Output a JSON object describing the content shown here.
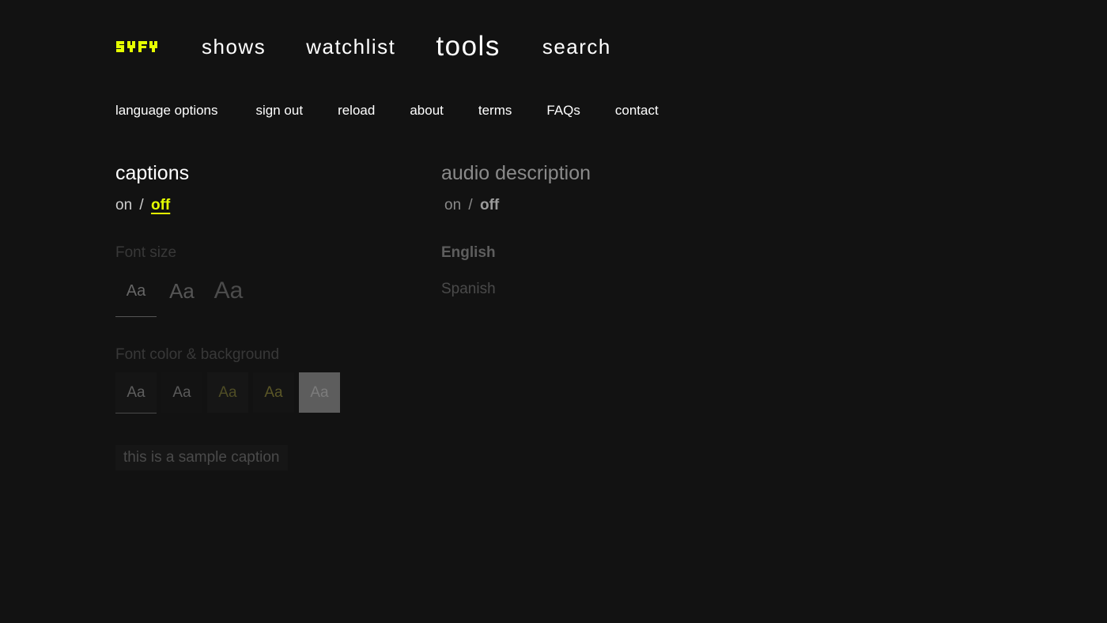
{
  "brand": {
    "logo_text": "SYFY",
    "accent_color": "#e5ff00"
  },
  "topnav": {
    "items": [
      {
        "label": "shows"
      },
      {
        "label": "watchlist"
      },
      {
        "label": "tools",
        "active": true
      },
      {
        "label": "search"
      }
    ]
  },
  "subnav": {
    "items": [
      {
        "label": "language options"
      },
      {
        "label": "sign out"
      },
      {
        "label": "reload"
      },
      {
        "label": "about"
      },
      {
        "label": "terms"
      },
      {
        "label": "FAQs"
      },
      {
        "label": "contact"
      }
    ]
  },
  "captions": {
    "title": "captions",
    "on_label": "on",
    "separator": "/",
    "off_label": "off",
    "selected": "off",
    "font_size_label": "Font size",
    "font_size_options": [
      "Aa",
      "Aa",
      "Aa"
    ],
    "font_color_label": "Font color & background",
    "font_color_options": [
      "Aa",
      "Aa",
      "Aa",
      "Aa",
      "Aa"
    ],
    "sample_caption": "this is a sample caption"
  },
  "audio_description": {
    "title": "audio description",
    "on_label": "on",
    "separator": "/",
    "off_label": "off",
    "selected": "off",
    "languages": [
      "English",
      "Spanish"
    ]
  }
}
